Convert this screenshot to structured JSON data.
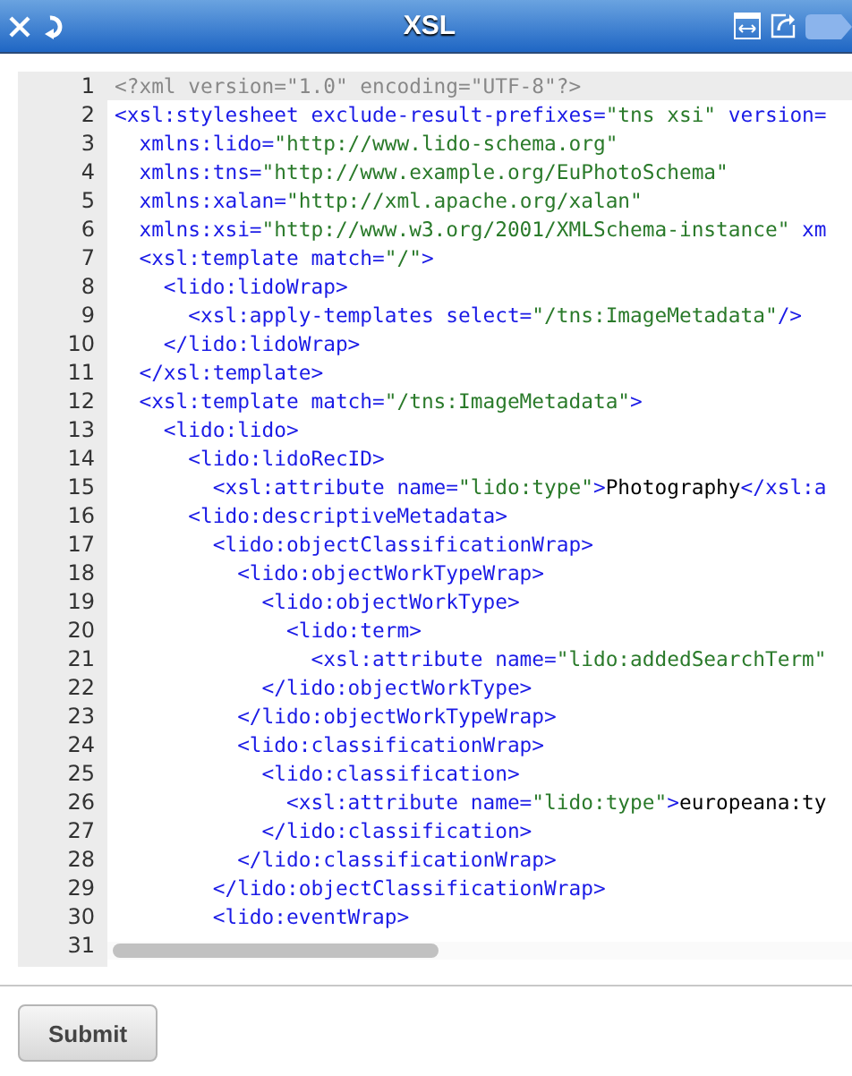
{
  "header": {
    "title": "XSL"
  },
  "editor": {
    "lines": [
      {
        "number": "1",
        "active": true,
        "tokens": [
          {
            "kind": "pi",
            "text": "<?xml version=\"1.0\" encoding=\"UTF-8\"?>"
          }
        ]
      },
      {
        "number": "2",
        "active": false,
        "tokens": [
          {
            "kind": "tag",
            "text": "<xsl:stylesheet exclude-result-prefixes="
          },
          {
            "kind": "value",
            "text": "\"tns xsi\""
          },
          {
            "kind": "tag",
            "text": " version="
          }
        ]
      },
      {
        "number": "3",
        "active": false,
        "tokens": [
          {
            "kind": "tag",
            "text": "  xmlns:lido="
          },
          {
            "kind": "value",
            "text": "\"http://www.lido-schema.org\""
          }
        ]
      },
      {
        "number": "4",
        "active": false,
        "tokens": [
          {
            "kind": "tag",
            "text": "  xmlns:tns="
          },
          {
            "kind": "value",
            "text": "\"http://www.example.org/EuPhotoSchema\""
          }
        ]
      },
      {
        "number": "5",
        "active": false,
        "tokens": [
          {
            "kind": "tag",
            "text": "  xmlns:xalan="
          },
          {
            "kind": "value",
            "text": "\"http://xml.apache.org/xalan\""
          }
        ]
      },
      {
        "number": "6",
        "active": false,
        "tokens": [
          {
            "kind": "tag",
            "text": "  xmlns:xsi="
          },
          {
            "kind": "value",
            "text": "\"http://www.w3.org/2001/XMLSchema-instance\""
          },
          {
            "kind": "tag",
            "text": " xm"
          }
        ]
      },
      {
        "number": "7",
        "active": false,
        "tokens": [
          {
            "kind": "tag",
            "text": "  <xsl:template match="
          },
          {
            "kind": "value",
            "text": "\"/\""
          },
          {
            "kind": "tag",
            "text": ">"
          }
        ]
      },
      {
        "number": "8",
        "active": false,
        "tokens": [
          {
            "kind": "tag",
            "text": "    <lido:lidoWrap>"
          }
        ]
      },
      {
        "number": "9",
        "active": false,
        "tokens": [
          {
            "kind": "tag",
            "text": "      <xsl:apply-templates select="
          },
          {
            "kind": "value",
            "text": "\"/tns:ImageMetadata\""
          },
          {
            "kind": "tag",
            "text": "/>"
          }
        ]
      },
      {
        "number": "10",
        "active": false,
        "tokens": [
          {
            "kind": "tag",
            "text": "    </lido:lidoWrap>"
          }
        ]
      },
      {
        "number": "11",
        "active": false,
        "tokens": [
          {
            "kind": "tag",
            "text": "  </xsl:template>"
          }
        ]
      },
      {
        "number": "12",
        "active": false,
        "tokens": [
          {
            "kind": "tag",
            "text": "  <xsl:template match="
          },
          {
            "kind": "value",
            "text": "\"/tns:ImageMetadata\""
          },
          {
            "kind": "tag",
            "text": ">"
          }
        ]
      },
      {
        "number": "13",
        "active": false,
        "tokens": [
          {
            "kind": "tag",
            "text": "    <lido:lido>"
          }
        ]
      },
      {
        "number": "14",
        "active": false,
        "tokens": [
          {
            "kind": "tag",
            "text": "      <lido:lidoRecID>"
          }
        ]
      },
      {
        "number": "15",
        "active": false,
        "tokens": [
          {
            "kind": "tag",
            "text": "        <xsl:attribute name="
          },
          {
            "kind": "value",
            "text": "\"lido:type\""
          },
          {
            "kind": "tag",
            "text": ">"
          },
          {
            "kind": "text",
            "text": "Photography"
          },
          {
            "kind": "tag",
            "text": "</xsl:a"
          }
        ]
      },
      {
        "number": "16",
        "active": false,
        "tokens": [
          {
            "kind": "tag",
            "text": "      <lido:descriptiveMetadata>"
          }
        ]
      },
      {
        "number": "17",
        "active": false,
        "tokens": [
          {
            "kind": "tag",
            "text": "        <lido:objectClassificationWrap>"
          }
        ]
      },
      {
        "number": "18",
        "active": false,
        "tokens": [
          {
            "kind": "tag",
            "text": "          <lido:objectWorkTypeWrap>"
          }
        ]
      },
      {
        "number": "19",
        "active": false,
        "tokens": [
          {
            "kind": "tag",
            "text": "            <lido:objectWorkType>"
          }
        ]
      },
      {
        "number": "20",
        "active": false,
        "tokens": [
          {
            "kind": "tag",
            "text": "              <lido:term>"
          }
        ]
      },
      {
        "number": "21",
        "active": false,
        "tokens": [
          {
            "kind": "tag",
            "text": "                <xsl:attribute name="
          },
          {
            "kind": "value",
            "text": "\"lido:addedSearchTerm\""
          }
        ]
      },
      {
        "number": "22",
        "active": false,
        "tokens": [
          {
            "kind": "tag",
            "text": "            </lido:objectWorkType>"
          }
        ]
      },
      {
        "number": "23",
        "active": false,
        "tokens": [
          {
            "kind": "tag",
            "text": "          </lido:objectWorkTypeWrap>"
          }
        ]
      },
      {
        "number": "24",
        "active": false,
        "tokens": [
          {
            "kind": "tag",
            "text": "          <lido:classificationWrap>"
          }
        ]
      },
      {
        "number": "25",
        "active": false,
        "tokens": [
          {
            "kind": "tag",
            "text": "            <lido:classification>"
          }
        ]
      },
      {
        "number": "26",
        "active": false,
        "tokens": [
          {
            "kind": "tag",
            "text": "              <xsl:attribute name="
          },
          {
            "kind": "value",
            "text": "\"lido:type\""
          },
          {
            "kind": "tag",
            "text": ">"
          },
          {
            "kind": "text",
            "text": "europeana:ty"
          }
        ]
      },
      {
        "number": "27",
        "active": false,
        "tokens": [
          {
            "kind": "tag",
            "text": "            </lido:classification>"
          }
        ]
      },
      {
        "number": "28",
        "active": false,
        "tokens": [
          {
            "kind": "tag",
            "text": "          </lido:classificationWrap>"
          }
        ]
      },
      {
        "number": "29",
        "active": false,
        "tokens": [
          {
            "kind": "tag",
            "text": "        </lido:objectClassificationWrap>"
          }
        ]
      },
      {
        "number": "30",
        "active": false,
        "tokens": [
          {
            "kind": "tag",
            "text": "        <lido:eventWrap>"
          }
        ]
      },
      {
        "number": "31",
        "active": false
      }
    ]
  },
  "submit": {
    "label": "Submit"
  }
}
